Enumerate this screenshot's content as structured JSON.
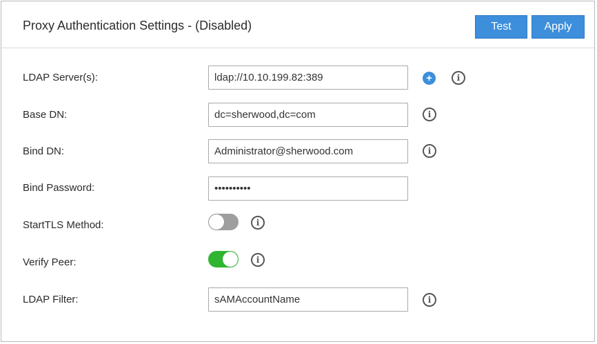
{
  "header": {
    "title": "Proxy Authentication Settings - (Disabled)",
    "test_label": "Test",
    "apply_label": "Apply"
  },
  "colors": {
    "accent": "#3d8edb",
    "toggle_on": "#2fb52f",
    "toggle_off": "#9e9e9e"
  },
  "fields": {
    "ldap_server": {
      "label": "LDAP Server(s):",
      "value": "ldap://10.10.199.82:389"
    },
    "base_dn": {
      "label": "Base DN:",
      "value": "dc=sherwood,dc=com"
    },
    "bind_dn": {
      "label": "Bind DN:",
      "value": "Administrator@sherwood.com"
    },
    "bind_password": {
      "label": "Bind Password:",
      "value": "••••••••••"
    },
    "starttls": {
      "label": "StartTLS Method:",
      "enabled": false
    },
    "verify_peer": {
      "label": "Verify Peer:",
      "enabled": true
    },
    "ldap_filter": {
      "label": "LDAP Filter:",
      "value": "sAMAccountName"
    }
  },
  "icons": {
    "info": "info-icon",
    "add": "add-circle-icon",
    "info_glyph": "i",
    "add_glyph": "+"
  }
}
